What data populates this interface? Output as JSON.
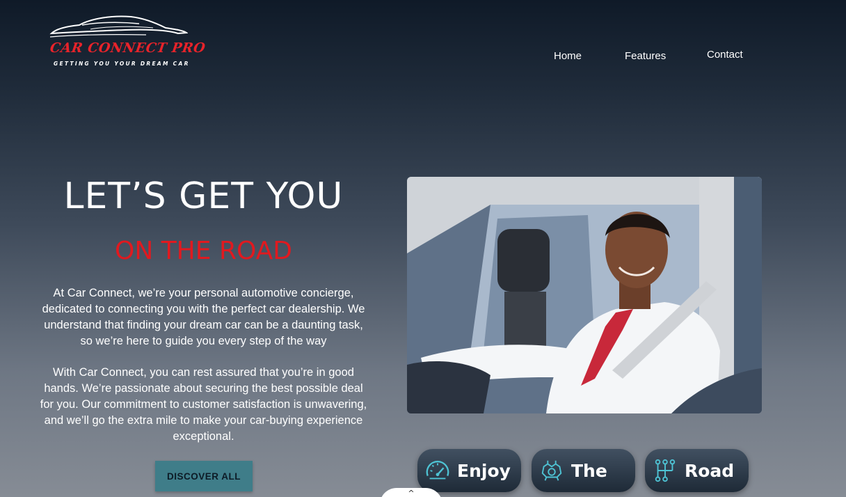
{
  "logo": {
    "title": "CAR CONNECT PRO",
    "tagline": "GETTING YOU YOUR DREAM CAR",
    "icon": "car-silhouette-icon"
  },
  "nav": {
    "items": [
      {
        "label": "Home"
      },
      {
        "label": "Features"
      },
      {
        "label": "Contact"
      }
    ]
  },
  "hero": {
    "headline": "LET’S GET YOU",
    "subheadline": "ON THE ROAD",
    "paragraph1": "At Car Connect, we’re your personal automotive concierge, dedicated to connecting you with the perfect car dealership. We understand that finding your dream car can be a daunting task, so we’re here to guide you every step of the way",
    "paragraph2": "With Car Connect, you can rest assured that you’re in good hands. We’re passionate about securing the best possible deal for you. Our commitment to customer satisfaction is unwavering, and we’ll go the extra mile to make your car-buying experience exceptional.",
    "cta_label": "DISCOVER ALL",
    "photo_alt": "Smiling man in white shirt and red tie driving a car"
  },
  "feature_pills": [
    {
      "label": "Enjoy",
      "icon": "speedometer-icon"
    },
    {
      "label": "The",
      "icon": "engine-icon"
    },
    {
      "label": "Road",
      "icon": "gear-shift-icon"
    }
  ],
  "scroll_tab": {
    "icon": "chevron-up-icon",
    "glyph": "^"
  },
  "colors": {
    "accent_red": "#e1191f",
    "button_teal": "#3f7d89",
    "icon_teal": "#4ec3d4",
    "background_top": "#0f1a28",
    "background_bottom": "#868c95"
  }
}
